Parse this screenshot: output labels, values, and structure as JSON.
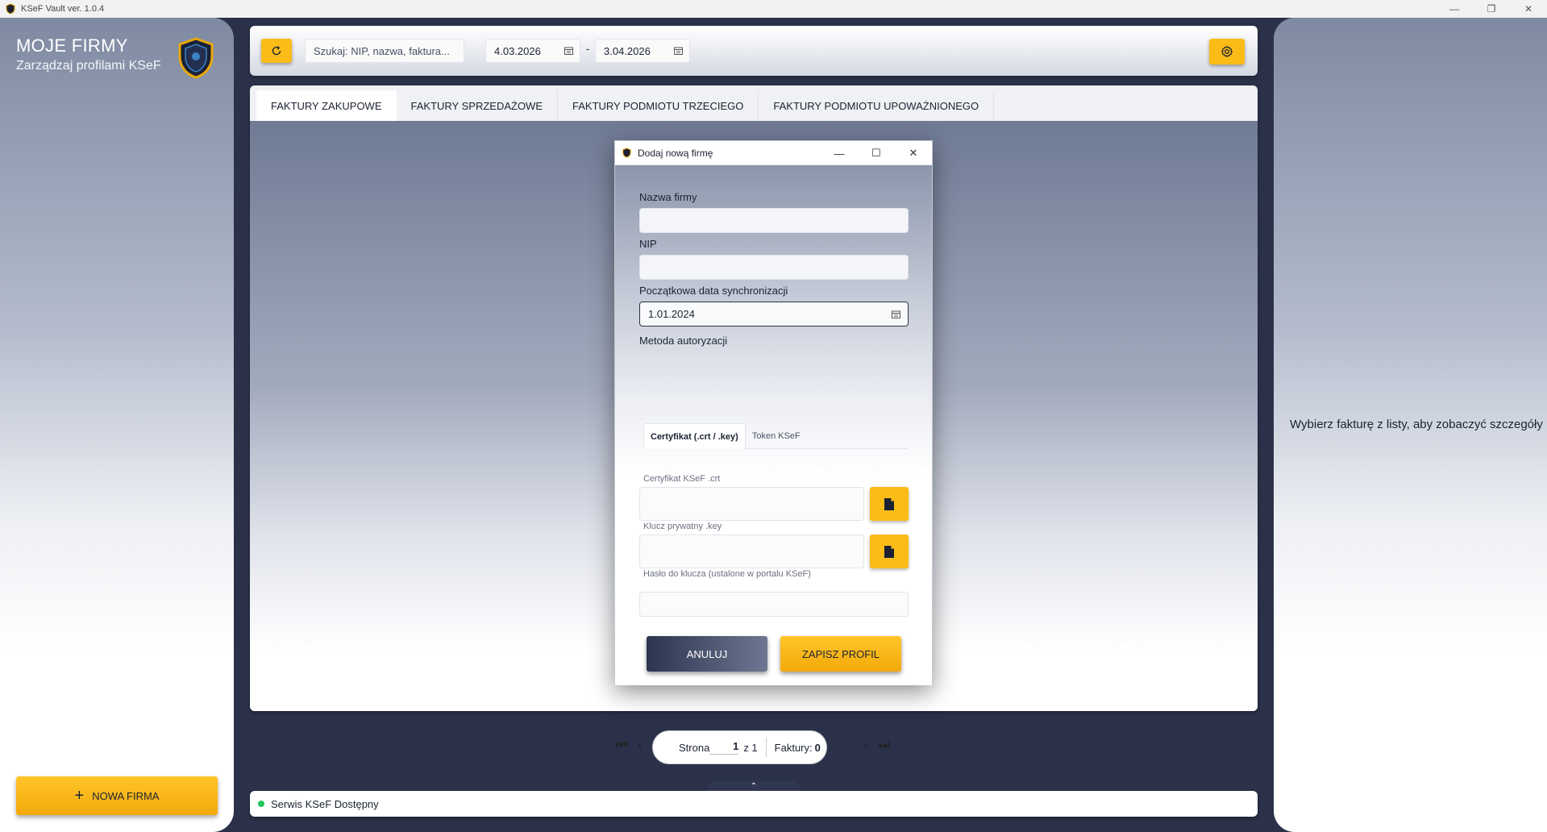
{
  "window": {
    "title": "KSeF Vault ver. 1.0.4",
    "minimize_icon": "minimize-icon",
    "maximize_icon": "restore-icon",
    "close_icon": "close-icon"
  },
  "sidebar": {
    "title": "MOJE FIRMY",
    "subtitle": "Zarządzaj profilami KSeF",
    "logo_icon": "shield-logo-icon",
    "new_firm_button": "NOWA FIRMA"
  },
  "toolbar": {
    "refresh_icon": "refresh-icon",
    "search_placeholder": "Szukaj: NIP, nazwa, faktura...",
    "date_from": "4.03.2026",
    "date_separator": "-",
    "date_to": "3.04.2026",
    "settings_icon": "gear-icon"
  },
  "tabs": [
    {
      "label": "FAKTURY ZAKUPOWE",
      "active": true
    },
    {
      "label": "FAKTURY SPRZEDAŻOWE",
      "active": false
    },
    {
      "label": "FAKTURY PODMIOTU TRZECIEGO",
      "active": false
    },
    {
      "label": "FAKTURY PODMIOTU UPOWAŻNIONEGO",
      "active": false
    }
  ],
  "pager": {
    "label": "Strona",
    "current_page": "1",
    "of_text": "z 1",
    "invoices_label": "Faktury:",
    "invoices_count": "0"
  },
  "status": {
    "text": "Serwis KSeF Dostępny",
    "color": "#22c55e"
  },
  "details_panel": {
    "hint": "Wybierz fakturę z listy, aby zobaczyć szczegóły"
  },
  "dialog": {
    "title": "Dodaj nową firmę",
    "company_name_label": "Nazwa firmy",
    "company_name_value": "",
    "nip_label": "NIP",
    "nip_value": "",
    "sync_date_label": "Początkowa data synchronizacji",
    "sync_date_value": "1.01.2024",
    "auth_method_label": "Metoda autoryzacji",
    "auth_tabs": [
      {
        "label": "Certyfikat (.crt / .key)",
        "active": true
      },
      {
        "label": "Token KSeF",
        "active": false
      }
    ],
    "cert_label": "Certyfikat KSeF .crt",
    "key_label": "Klucz prywatny .key",
    "password_label": "Hasło do klucza (ustalone w portalu KSeF)",
    "cancel_button": "ANULUJ",
    "save_button": "ZAPISZ PROFIL"
  },
  "colors": {
    "accent": "#fbbc18",
    "dark": "#2c3550",
    "background": "#2a3148"
  }
}
